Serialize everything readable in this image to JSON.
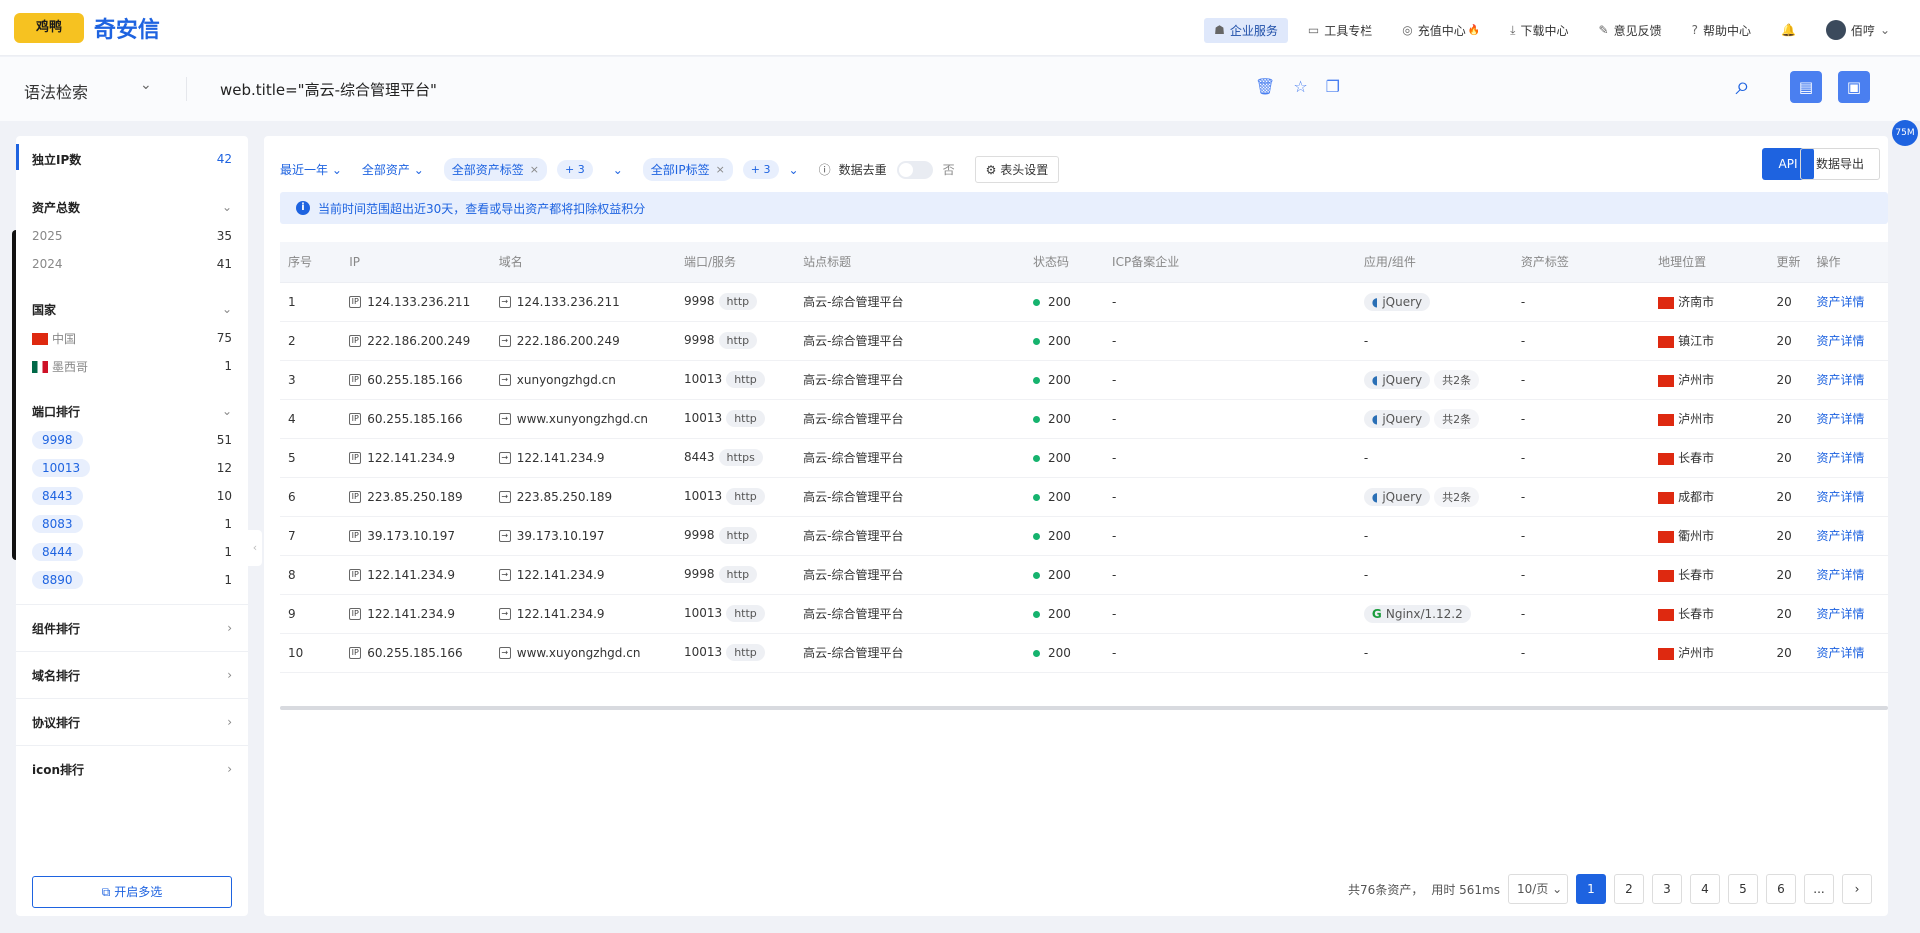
{
  "brand": {
    "logo_text": "奇安信",
    "badge_text": "鸡鸭"
  },
  "nav": [
    {
      "label": "企业服务",
      "icon": "user-service-icon",
      "active": true
    },
    {
      "label": "工具专栏",
      "icon": "toolbox-icon"
    },
    {
      "label": "充值中心",
      "icon": "recharge-icon",
      "fire": "🔥"
    },
    {
      "label": "下载中心",
      "icon": "download-icon"
    },
    {
      "label": "意见反馈",
      "icon": "feedback-icon"
    },
    {
      "label": "帮助中心",
      "icon": "help-icon"
    }
  ],
  "user": {
    "name": "佰哼"
  },
  "search": {
    "mode": "语法检索",
    "query": "web.title=\"高云-综合管理平台\""
  },
  "side": {
    "ip_count": {
      "label": "独立IP数",
      "value": "42"
    },
    "asset_total": {
      "label": "资产总数",
      "years": [
        {
          "label": "2025",
          "value": "35"
        },
        {
          "label": "2024",
          "value": "41"
        }
      ]
    },
    "country": {
      "label": "国家",
      "items": [
        {
          "label": "中国",
          "value": "75"
        },
        {
          "label": "墨西哥",
          "value": "1"
        }
      ]
    },
    "port_rank": {
      "label": "端口排行",
      "items": [
        {
          "label": "9998",
          "value": "51"
        },
        {
          "label": "10013",
          "value": "12"
        },
        {
          "label": "8443",
          "value": "10"
        },
        {
          "label": "8083",
          "value": "1"
        },
        {
          "label": "8444",
          "value": "1"
        },
        {
          "label": "8890",
          "value": "1"
        }
      ]
    },
    "component_rank": "组件排行",
    "domain_rank": "域名排行",
    "protocol_rank": "协议排行",
    "icon_rank": "icon排行",
    "multi_select": "开启多选"
  },
  "filters": {
    "time": "最近一年",
    "asset": "全部资产",
    "asset_tag": "全部资产标签",
    "asset_tag_more": "+ 3",
    "ip_tag": "全部IP标签",
    "ip_tag_more": "+ 3",
    "dedupe": "数据去重",
    "dedupe_value": "否",
    "header_settings": "表头设置",
    "api": "API",
    "export": "数据导出"
  },
  "notice": "当前时间范围超出近30天，查看或导出资产都将扣除权益积分",
  "table": {
    "headers": [
      "序号",
      "IP",
      "域名",
      "端口/服务",
      "站点标题",
      "状态码",
      "ICP备案企业",
      "应用/组件",
      "资产标签",
      "地理位置",
      "更新",
      "操作"
    ],
    "rows": [
      {
        "n": "1",
        "ip": "124.133.236.211",
        "domain": "124.133.236.211",
        "port": "9998",
        "proto": "http",
        "title": "高云-综合管理平台",
        "status": "200",
        "icp": "-",
        "app": "jQuery",
        "more": "",
        "tag": "-",
        "geo": "济南市",
        "upd": "20",
        "op": "资产详情"
      },
      {
        "n": "2",
        "ip": "222.186.200.249",
        "domain": "222.186.200.249",
        "port": "9998",
        "proto": "http",
        "title": "高云-综合管理平台",
        "status": "200",
        "icp": "-",
        "app": "-",
        "more": "",
        "tag": "-",
        "geo": "镇江市",
        "upd": "20",
        "op": "资产详情"
      },
      {
        "n": "3",
        "ip": "60.255.185.166",
        "domain": "xunyongzhgd.cn",
        "port": "10013",
        "proto": "http",
        "title": "高云-综合管理平台",
        "status": "200",
        "icp": "-",
        "app": "jQuery",
        "more": "共2条",
        "tag": "-",
        "geo": "泸州市",
        "upd": "20",
        "op": "资产详情"
      },
      {
        "n": "4",
        "ip": "60.255.185.166",
        "domain": "www.xunyongzhgd.cn",
        "port": "10013",
        "proto": "http",
        "title": "高云-综合管理平台",
        "status": "200",
        "icp": "-",
        "app": "jQuery",
        "more": "共2条",
        "tag": "-",
        "geo": "泸州市",
        "upd": "20",
        "op": "资产详情"
      },
      {
        "n": "5",
        "ip": "122.141.234.9",
        "domain": "122.141.234.9",
        "port": "8443",
        "proto": "https",
        "title": "高云-综合管理平台",
        "status": "200",
        "icp": "-",
        "app": "-",
        "more": "",
        "tag": "-",
        "geo": "长春市",
        "upd": "20",
        "op": "资产详情"
      },
      {
        "n": "6",
        "ip": "223.85.250.189",
        "domain": "223.85.250.189",
        "port": "10013",
        "proto": "http",
        "title": "高云-综合管理平台",
        "status": "200",
        "icp": "-",
        "app": "jQuery",
        "more": "共2条",
        "tag": "-",
        "geo": "成都市",
        "upd": "20",
        "op": "资产详情"
      },
      {
        "n": "7",
        "ip": "39.173.10.197",
        "domain": "39.173.10.197",
        "port": "9998",
        "proto": "http",
        "title": "高云-综合管理平台",
        "status": "200",
        "icp": "-",
        "app": "-",
        "more": "",
        "tag": "-",
        "geo": "衢州市",
        "upd": "20",
        "op": "资产详情"
      },
      {
        "n": "8",
        "ip": "122.141.234.9",
        "domain": "122.141.234.9",
        "port": "9998",
        "proto": "http",
        "title": "高云-综合管理平台",
        "status": "200",
        "icp": "-",
        "app": "-",
        "more": "",
        "tag": "-",
        "geo": "长春市",
        "upd": "20",
        "op": "资产详情"
      },
      {
        "n": "9",
        "ip": "122.141.234.9",
        "domain": "122.141.234.9",
        "port": "10013",
        "proto": "http",
        "title": "高云-综合管理平台",
        "status": "200",
        "icp": "-",
        "app": "Nginx/1.12.2",
        "more": "",
        "tag": "-",
        "geo": "长春市",
        "upd": "20",
        "op": "资产详情"
      },
      {
        "n": "10",
        "ip": "60.255.185.166",
        "domain": "www.xuyongzhgd.cn",
        "port": "10013",
        "proto": "http",
        "title": "高云-综合管理平台",
        "status": "200",
        "icp": "-",
        "app": "-",
        "more": "",
        "tag": "-",
        "geo": "泸州市",
        "upd": "20",
        "op": "资产详情"
      }
    ]
  },
  "pager": {
    "total": "共76条资产，",
    "time": "用时 561ms",
    "size": "10/页",
    "pages": [
      "1",
      "2",
      "3",
      "4",
      "5",
      "6",
      "..."
    ],
    "current": "1"
  },
  "floating_badge": "75M"
}
